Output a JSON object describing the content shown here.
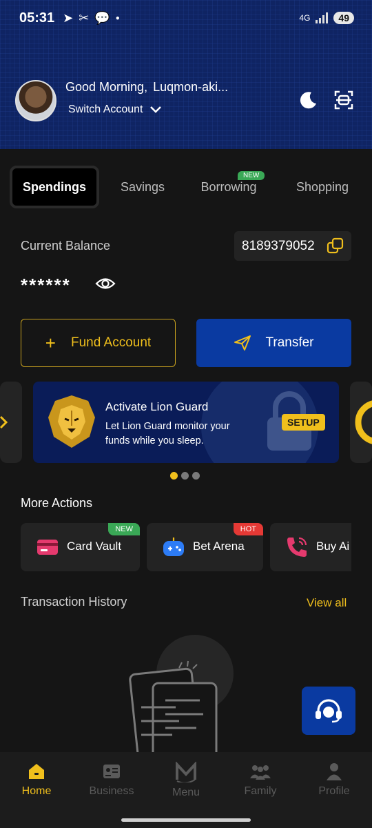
{
  "status_bar": {
    "time": "05:31",
    "network": "4G",
    "battery": "49"
  },
  "header": {
    "greeting": "Good Morning,",
    "user_name": "Luqmon-aki...",
    "switch_account": "Switch Account"
  },
  "tabs": [
    {
      "label": "Spendings",
      "active": true
    },
    {
      "label": "Savings"
    },
    {
      "label": "Borrowing",
      "badge": "NEW"
    },
    {
      "label": "Shopping"
    }
  ],
  "balance": {
    "label": "Current Balance",
    "account_number": "8189379052",
    "masked_value": "******"
  },
  "actions": {
    "fund": "Fund Account",
    "transfer": "Transfer"
  },
  "banner": {
    "title": "Activate Lion Guard",
    "description": "Let Lion Guard monitor your funds while you sleep.",
    "cta": "SETUP"
  },
  "more_actions": {
    "title": "More Actions",
    "items": [
      {
        "label": "Card Vault",
        "badge": "NEW"
      },
      {
        "label": "Bet Arena",
        "badge": "HOT"
      },
      {
        "label": "Buy Ai"
      }
    ]
  },
  "transactions": {
    "title": "Transaction History",
    "view_all": "View all"
  },
  "nav": [
    {
      "label": "Home",
      "active": true
    },
    {
      "label": "Business"
    },
    {
      "label": "Menu"
    },
    {
      "label": "Family"
    },
    {
      "label": "Profile"
    }
  ],
  "colors": {
    "accent": "#f0bf1c",
    "primary_blue": "#0a3aa1",
    "background": "#151515"
  }
}
